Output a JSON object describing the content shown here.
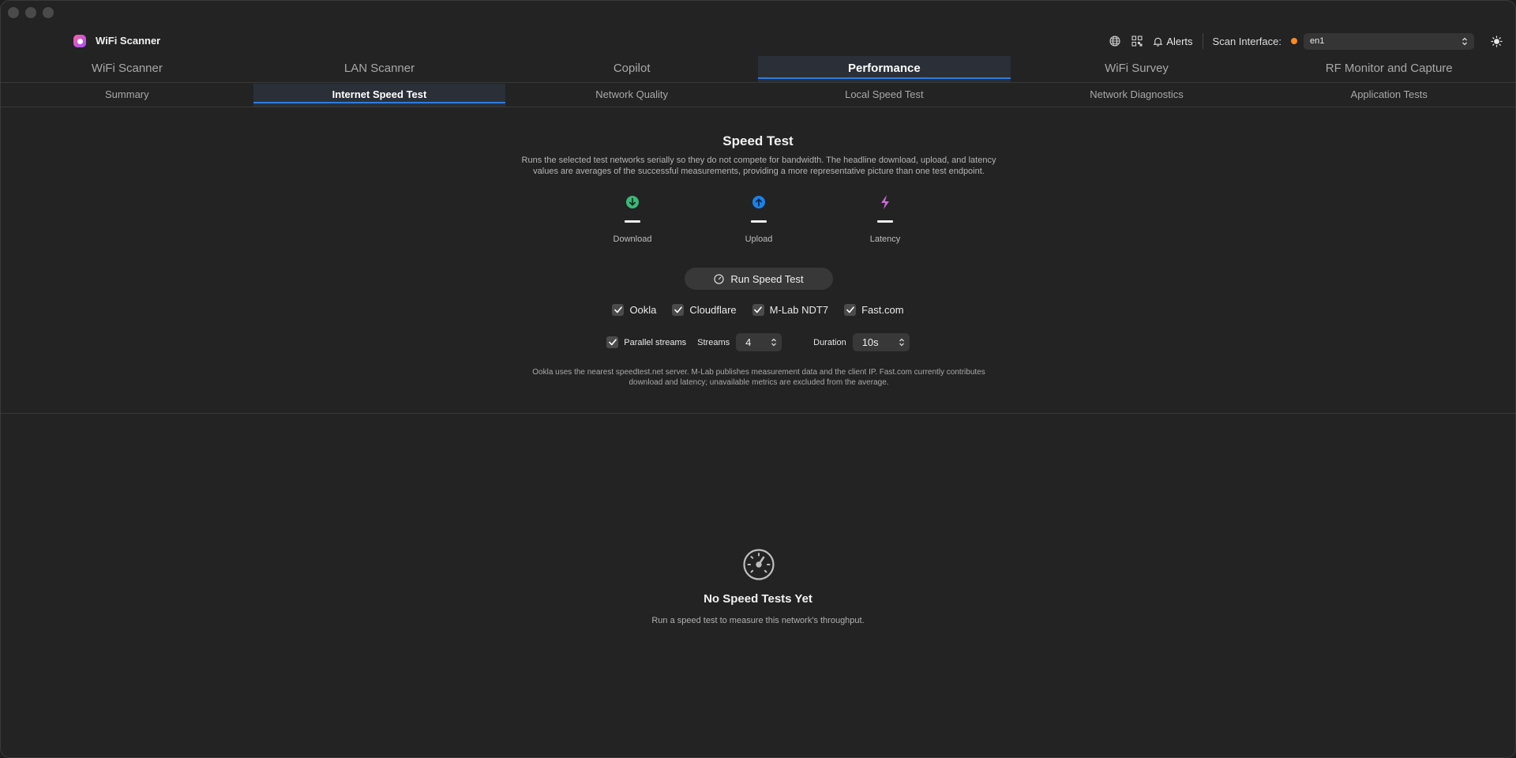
{
  "app": {
    "title": "WiFi Scanner"
  },
  "header": {
    "alerts_label": "Alerts",
    "scan_interface_label": "Scan Interface:",
    "scan_interface_value": "en1",
    "status_color": "#ff8a1f"
  },
  "main_tabs": [
    {
      "label": "WiFi Scanner"
    },
    {
      "label": "LAN Scanner"
    },
    {
      "label": "Copilot"
    },
    {
      "label": "Performance",
      "active": true
    },
    {
      "label": "WiFi Survey"
    },
    {
      "label": "RF Monitor and Capture"
    }
  ],
  "sub_tabs": [
    {
      "label": "Summary"
    },
    {
      "label": "Internet Speed Test",
      "active": true
    },
    {
      "label": "Network Quality"
    },
    {
      "label": "Local Speed Test"
    },
    {
      "label": "Network Diagnostics"
    },
    {
      "label": "Application Tests"
    }
  ],
  "speed_test": {
    "title": "Speed Test",
    "description_line1": "Runs the selected test networks serially so they do not compete for bandwidth. The headline download, upload, and latency",
    "description_line2": "values are averages of the successful measurements, providing a more representative picture than one test endpoint.",
    "metrics": {
      "download": {
        "label": "Download",
        "value": "—",
        "icon": "arrow-down-circle-icon",
        "color": "#3cb878"
      },
      "upload": {
        "label": "Upload",
        "value": "—",
        "icon": "arrow-up-circle-icon",
        "color": "#1a82e8"
      },
      "latency": {
        "label": "Latency",
        "value": "—",
        "icon": "bolt-icon",
        "color": "#c86bd8"
      }
    },
    "run_button_label": "Run Speed Test",
    "providers": [
      {
        "label": "Ookla",
        "checked": true
      },
      {
        "label": "Cloudflare",
        "checked": true
      },
      {
        "label": "M-Lab NDT7",
        "checked": true
      },
      {
        "label": "Fast.com",
        "checked": true
      }
    ],
    "parallel_streams": {
      "label": "Parallel streams",
      "checked": true
    },
    "streams": {
      "label": "Streams",
      "value": "4"
    },
    "duration": {
      "label": "Duration",
      "value": "10s"
    },
    "note_line1": "Ookla uses the nearest speedtest.net server. M-Lab publishes measurement data and the client IP. Fast.com currently contributes",
    "note_line2": "download and latency; unavailable metrics are excluded from the average."
  },
  "empty_state": {
    "title": "No Speed Tests Yet",
    "subtitle": "Run a speed test to measure this network's throughput.",
    "icon": "speedometer-icon"
  }
}
